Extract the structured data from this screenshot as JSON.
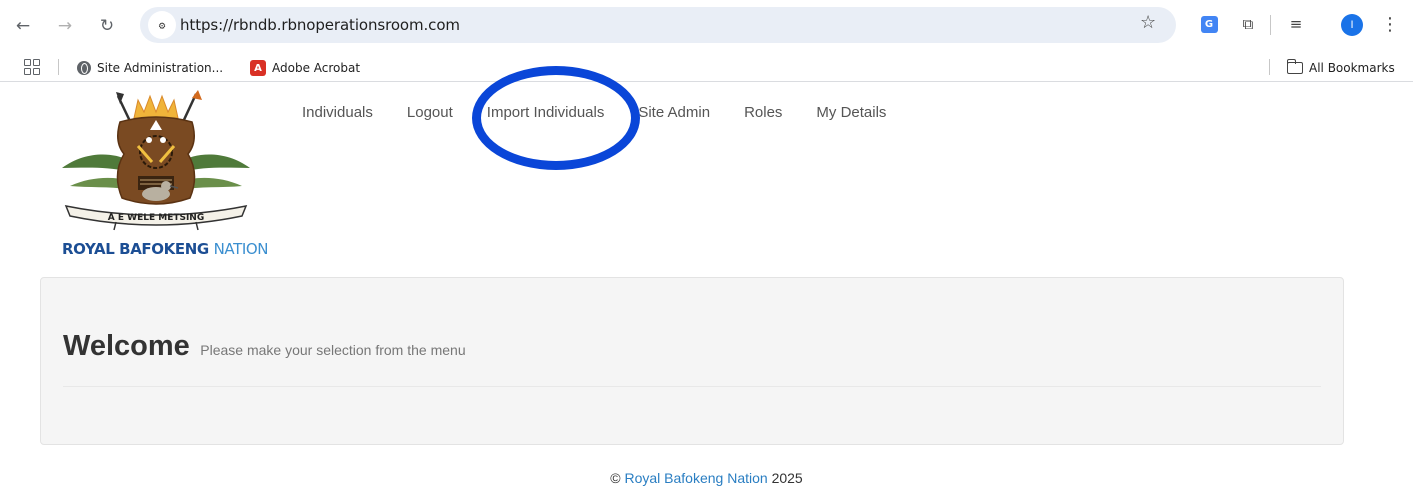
{
  "browser": {
    "url": "https://rbndb.rbnoperationsroom.com",
    "profile_initial": "I",
    "bookmarks": {
      "items": [
        {
          "label": "Site Administration...",
          "icon": "globe-icon"
        },
        {
          "label": "Adobe Acrobat",
          "icon": "acrobat-icon"
        }
      ],
      "all_bookmarks_label": "All Bookmarks"
    }
  },
  "header": {
    "logo": {
      "motto": "A E WELE METSING",
      "name_bold": "ROYAL BAFOKENG",
      "name_light": "NATION"
    },
    "nav": [
      "Individuals",
      "Logout",
      "Import Individuals",
      "Site Admin",
      "Roles",
      "My Details"
    ]
  },
  "main": {
    "welcome_title": "Welcome",
    "welcome_subtitle": "Please make your selection from the menu"
  },
  "footer": {
    "copyright_symbol": "©",
    "link_text": "Royal Bafokeng Nation",
    "year": "2025"
  },
  "colors": {
    "annotation_ring": "#0a46d8",
    "link": "#2a7ec2",
    "logo_blue": "#1c4e94"
  }
}
